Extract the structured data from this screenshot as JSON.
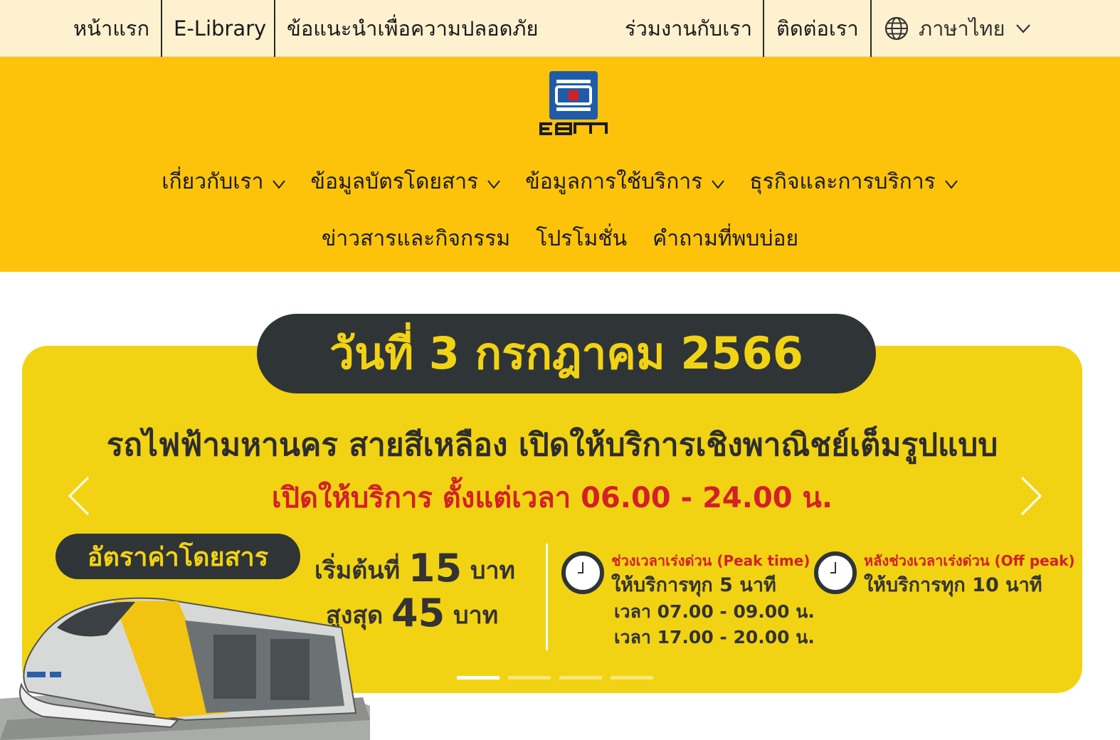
{
  "topbar": {
    "home": "หน้าแรก",
    "elibrary": "E-Library",
    "safety": "ข้อแนะนำเพื่อความปลอดภัย",
    "careers": "ร่วมงานกับเรา",
    "contact": "ติดต่อเรา",
    "language": "ภาษาไทย"
  },
  "header": {
    "logo_text": "EBM",
    "nav_row1": [
      {
        "label": "เกี่ยวกับเรา"
      },
      {
        "label": "ข้อมูลบัตรโดยสาร"
      },
      {
        "label": "ข้อมูลการใช้บริการ"
      },
      {
        "label": "ธุรกิจและการบริการ"
      }
    ],
    "nav_row2": [
      {
        "label": "ข่าวสารและกิจกรรม"
      },
      {
        "label": "โปรโมชั่น"
      },
      {
        "label": "คำถามที่พบบ่อย"
      }
    ]
  },
  "banner": {
    "date": "วันที่ 3 กรกฎาคม 2566",
    "headline": "รถไฟฟ้ามหานคร สายสีเหลือง เปิดให้บริการเชิงพาณิชย์เต็มรูปแบบ",
    "hours": "เปิดให้บริการ ตั้งแต่เวลา 06.00 - 24.00 น.",
    "fare_label": "อัตราค่าโดยสาร",
    "fare_start_prefix": "เริ่มต้นที่",
    "fare_start_value": "15",
    "fare_max_prefix": "สูงสุด",
    "fare_max_value": "45",
    "currency": "บาท",
    "peak_title": "ช่วงเวลาเร่งด่วน (Peak time)",
    "peak_freq": "ให้บริการทุก 5 นาที",
    "peak_time1": "เวลา 07.00 - 09.00 น.",
    "peak_time2": "เวลา 17.00 - 20.00 น.",
    "off_title": "หลังช่วงเวลาเร่งด่วน (Off peak)",
    "off_freq": "ให้บริการทุก 10 นาที",
    "slides": 4,
    "active_slide": 1
  },
  "colors": {
    "topbar_bg": "#fdf1cf",
    "header_yellow": "#fcc30a",
    "banner_yellow": "#f2d313",
    "dark_pill": "#2f3537",
    "accent_red": "#d32027",
    "logo_blue": "#1f5ba8"
  },
  "icons": [
    "globe-icon",
    "chevron-down-icon",
    "ebm-logo",
    "chevron-left-icon",
    "chevron-right-icon",
    "clock-icon"
  ]
}
